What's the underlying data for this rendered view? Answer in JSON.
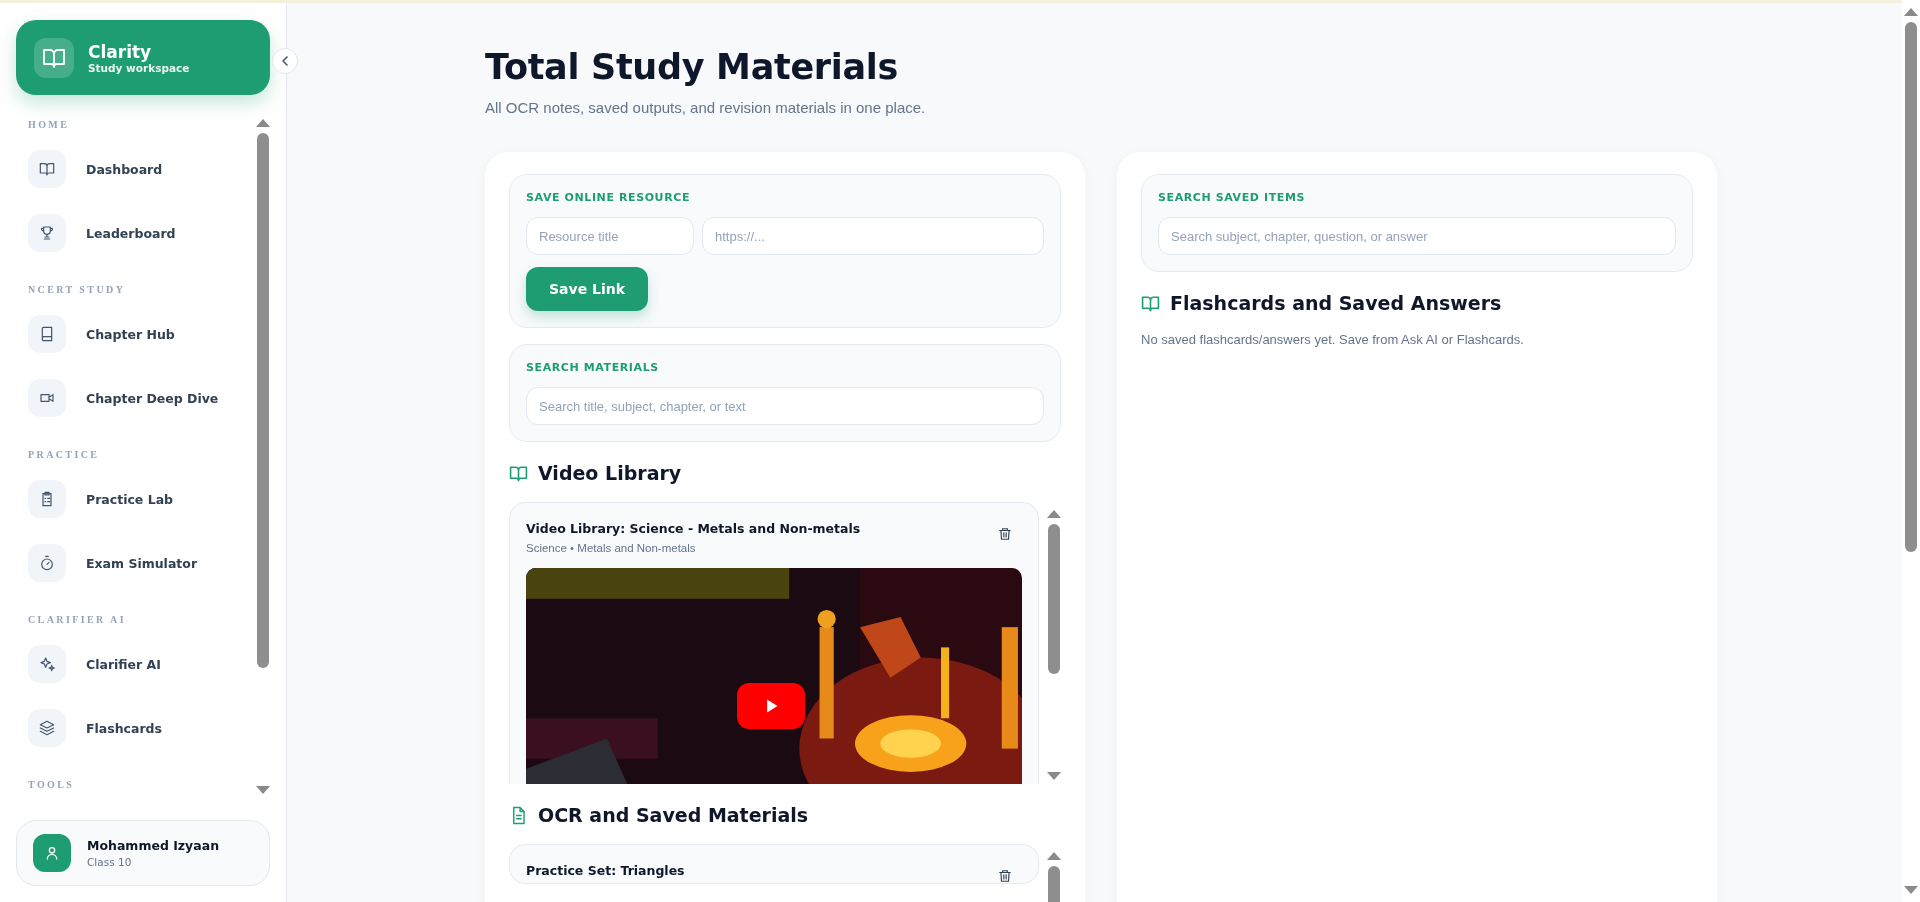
{
  "sidebar": {
    "brand": {
      "title": "Clarity",
      "subtitle": "Study workspace"
    },
    "sections": [
      {
        "label": "HOME",
        "items": [
          {
            "label": "Dashboard",
            "kind": "book"
          },
          {
            "label": "Leaderboard",
            "kind": "trophy"
          }
        ]
      },
      {
        "label": "NCERT STUDY",
        "items": [
          {
            "label": "Chapter Hub",
            "kind": "notebook"
          },
          {
            "label": "Chapter Deep Dive",
            "kind": "video"
          }
        ]
      },
      {
        "label": "PRACTICE",
        "items": [
          {
            "label": "Practice Lab",
            "kind": "clipboard"
          },
          {
            "label": "Exam Simulator",
            "kind": "timer"
          }
        ]
      },
      {
        "label": "CLARIFIER AI",
        "items": [
          {
            "label": "Clarifier AI",
            "kind": "sparkles"
          },
          {
            "label": "Flashcards",
            "kind": "layers"
          }
        ]
      },
      {
        "label": "TOOLS"
      }
    ],
    "user": {
      "name": "Mohammed Izyaan",
      "detail": "Class 10"
    }
  },
  "header": {
    "title": "Total Study Materials",
    "subtitle": "All OCR notes, saved outputs, and revision materials in one place."
  },
  "save_resource": {
    "label": "SAVE ONLINE RESOURCE",
    "title_placeholder": "Resource title",
    "url_placeholder": "https://...",
    "button": "Save Link"
  },
  "search_materials": {
    "label": "SEARCH MATERIALS",
    "placeholder": "Search title, subject, chapter, or text"
  },
  "video_library": {
    "heading": "Video Library",
    "items": [
      {
        "title": "Video Library: Science - Metals and Non-metals",
        "meta": "Science • Metals and Non-metals",
        "kind": "picture"
      }
    ]
  },
  "ocr_materials": {
    "heading": "OCR and Saved Materials",
    "items": [
      {
        "title": "Practice Set: Triangles"
      }
    ]
  },
  "saved_search": {
    "label": "SEARCH SAVED ITEMS",
    "placeholder": "Search subject, chapter, question, or answer"
  },
  "flashcards": {
    "heading": "Flashcards and Saved Answers",
    "empty_text": "No saved flashcards/answers yet. Save from Ask AI or Flashcards."
  }
}
